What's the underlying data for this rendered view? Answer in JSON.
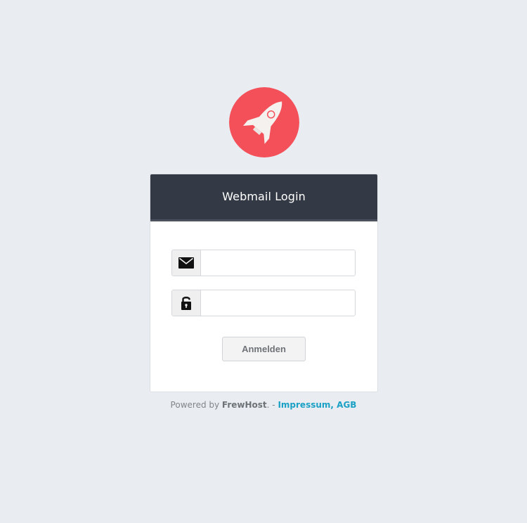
{
  "logo": {
    "icon": "rocket-icon",
    "bg_color": "#f4505a"
  },
  "login": {
    "title": "Webmail Login",
    "email": {
      "icon": "envelope-icon",
      "value": "",
      "placeholder": ""
    },
    "password": {
      "icon": "lock-icon",
      "value": "",
      "placeholder": ""
    },
    "submit_label": "Anmelden"
  },
  "footer": {
    "powered_by": "Powered by ",
    "brand": "FrewHost",
    "separator": ". - ",
    "impressum": "Impressum",
    "comma": ", ",
    "agb": "AGB"
  },
  "colors": {
    "background": "#e9ecf1",
    "header": "#343a45",
    "link": "#1aa1c5",
    "accent": "#f4505a"
  }
}
